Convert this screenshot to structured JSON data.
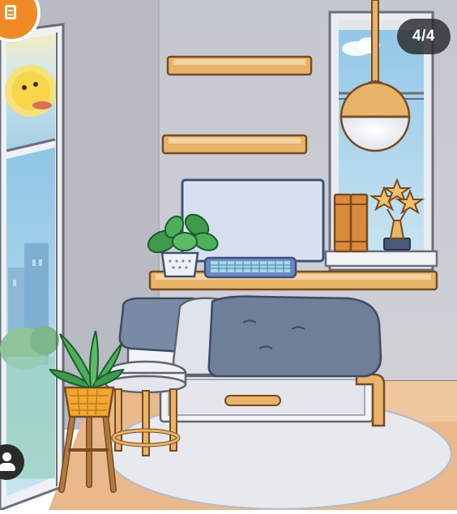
{
  "viewer": {
    "page_indicator": "4/4",
    "current_page": 4,
    "total_pages": 4
  },
  "controls": {
    "corner_button_icon": "edit-page-icon",
    "user_button_icon": "user-icon"
  },
  "scene": {
    "room": "bedroom",
    "items": [
      "wall-shelf",
      "wall-shelf",
      "computer-monitor",
      "keyboard",
      "potted-plant",
      "books",
      "trophy",
      "pendant-lamp",
      "desk-shelf",
      "bed",
      "pillow",
      "blanket",
      "side-table",
      "plant-stand",
      "round-rug",
      "window",
      "glass-door"
    ]
  },
  "colors": {
    "wall": "#c9ccd4",
    "wood": "#e8b46a",
    "wood_outline": "#7a4a22",
    "bed_blanket": "#6f7f98",
    "sky": "#a9d6ee",
    "accent_orange": "#f08a24",
    "badge": "#2f2f2f"
  }
}
